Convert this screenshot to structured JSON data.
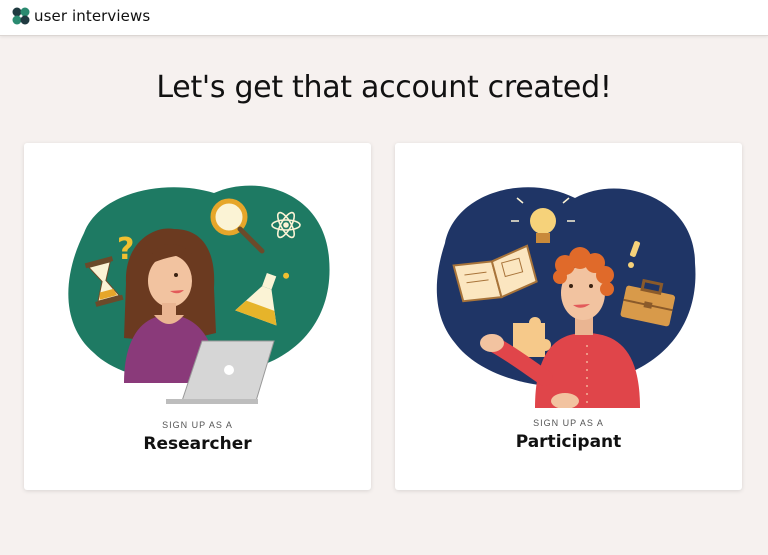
{
  "header": {
    "brand": "user interviews",
    "logo_icon": "user-interviews-logo-icon"
  },
  "main": {
    "title": "Let's get that account created!"
  },
  "cards": [
    {
      "kicker": "SIGN UP AS A",
      "role": "Researcher",
      "illustration": "researcher-illustration"
    },
    {
      "kicker": "SIGN UP AS A",
      "role": "Participant",
      "illustration": "participant-illustration"
    }
  ],
  "colors": {
    "background": "#f6f1ef",
    "researcher_blob": "#1e7a63",
    "participant_blob": "#1f3566"
  }
}
